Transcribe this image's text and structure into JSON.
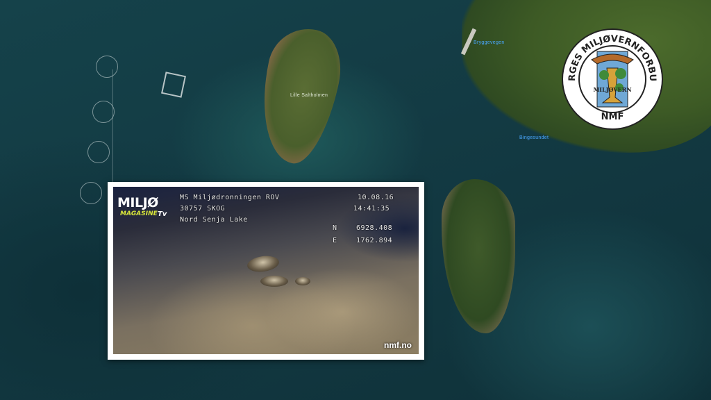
{
  "map": {
    "island_label": "Lille Saltholmen",
    "road_label": "Bryggevegen",
    "sound_label": "Bingesundet"
  },
  "logo": {
    "ring_text": "NORGES MILJØVERNFORBUND",
    "center_text": "MILJØVERN",
    "bottom_text": "NMF",
    "colors": {
      "blue": "#6fa8d6",
      "brown": "#b46a2a",
      "green": "#3f8a3a",
      "gold": "#d6a23a",
      "ring": "#222222"
    }
  },
  "photo": {
    "brand_main": "MILJØ",
    "brand_sub": "MAGASINE",
    "brand_tv": "Tv",
    "vessel": "MS Miljødronningen ROV",
    "code": "30757 SKOG",
    "location": "Nord Senja Lake",
    "date": "10.08.16",
    "time": "14:41:35",
    "north_label": "N",
    "north_value": "6928.408",
    "east_label": "E",
    "east_value": "1762.894",
    "url": "nmf.no"
  }
}
